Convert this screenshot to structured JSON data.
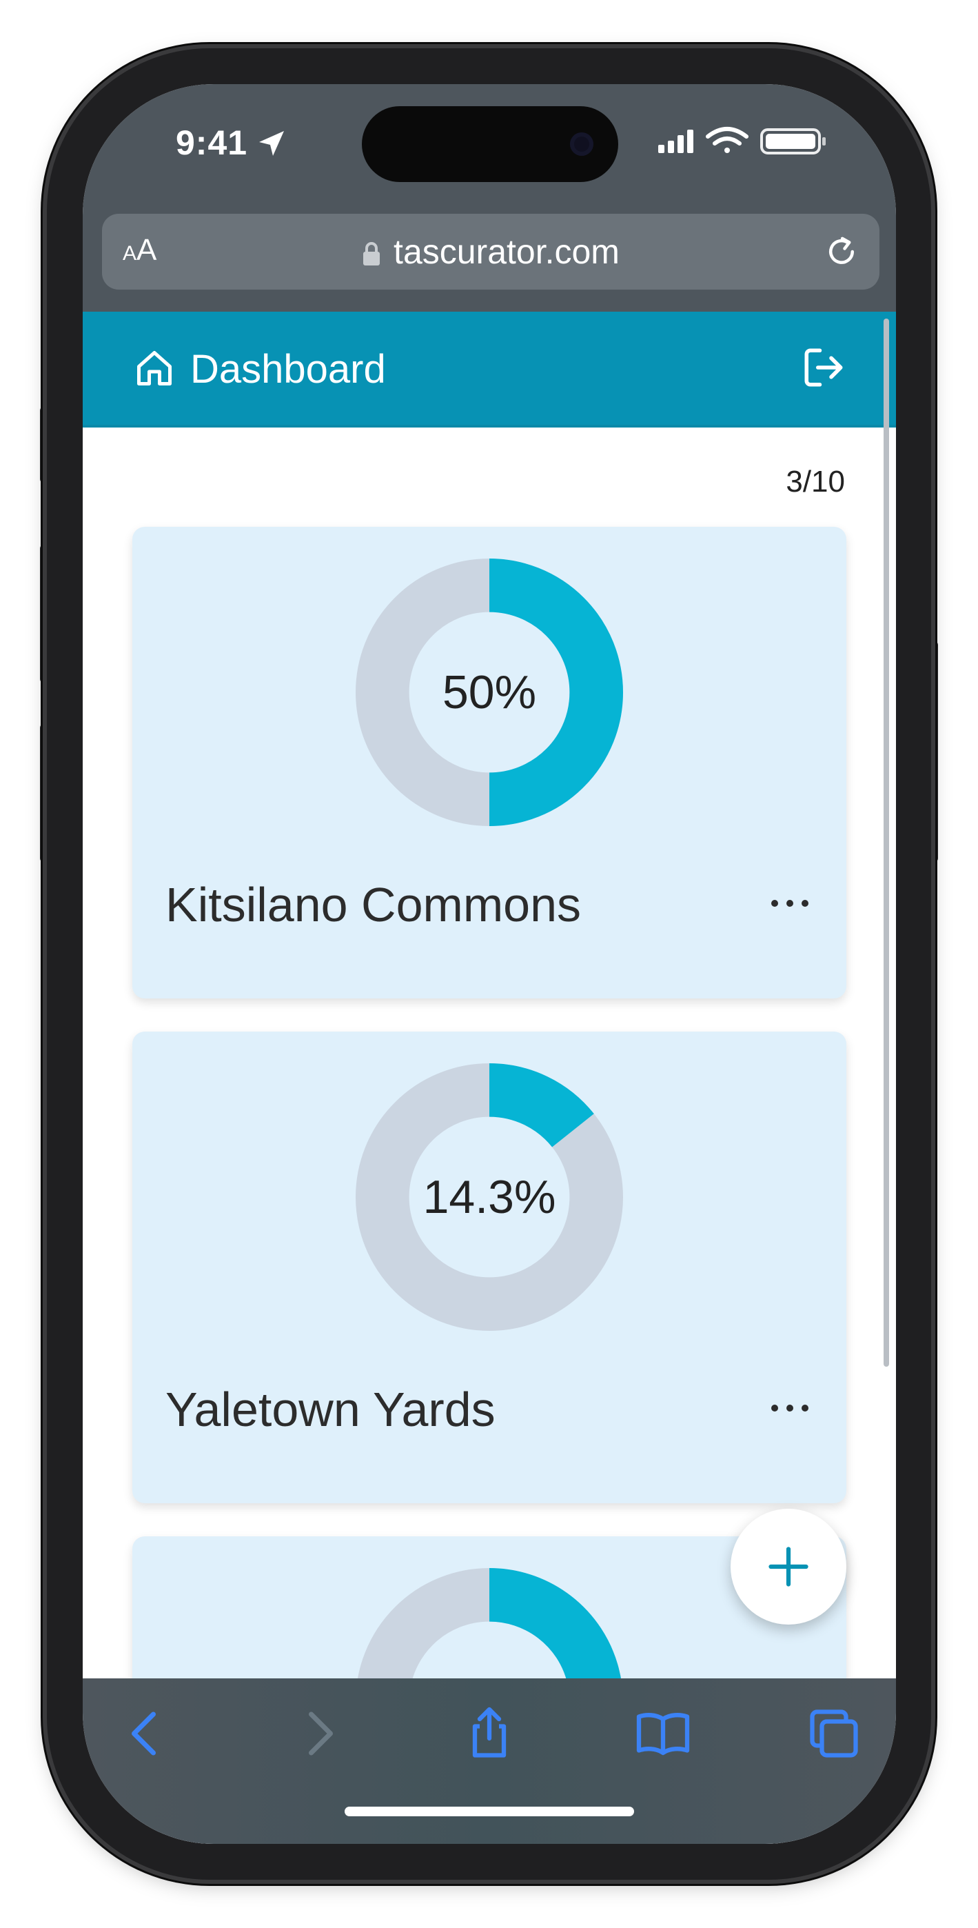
{
  "status_bar": {
    "time": "9:41"
  },
  "browser": {
    "text_size_small": "A",
    "text_size_large": "A",
    "url": "tascurator.com"
  },
  "header": {
    "title": "Dashboard"
  },
  "page_counter": "3/10",
  "projects": [
    {
      "name": "Kitsilano Commons",
      "progress_label": "50%",
      "progress": 0.5
    },
    {
      "name": "Yaletown Yards",
      "progress_label": "14.3%",
      "progress": 0.143
    },
    {
      "name": "",
      "progress_label": "",
      "progress": 0.417
    }
  ],
  "colors": {
    "accent": "#0792b4",
    "donut_fill": "#06b4d4",
    "donut_track": "#cbd5e1",
    "card_bg": "#dff0fb",
    "browser_chrome": "#4e565d",
    "toolbar_icon": "#3b82f6"
  },
  "icons": {
    "home": "home-icon",
    "logout": "logout-icon",
    "more": "more-horizontal-icon",
    "add": "plus-icon"
  }
}
